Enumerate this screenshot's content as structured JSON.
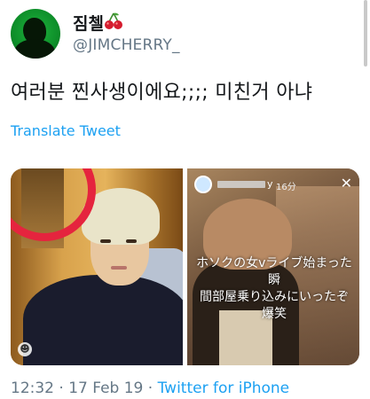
{
  "author": {
    "display_name": "짐첼",
    "handle": "@JIMCHERRY_",
    "emoji": "🍒"
  },
  "tweet": {
    "text": "여러분 찐사생이에요;;;; 미친거 아냐",
    "translate_label": "Translate Tweet"
  },
  "media": {
    "right_story": {
      "username_tail": "y",
      "time": "16分",
      "overlay_text": "ホソクの女vライブ始まった瞬\n間部屋乗り込みにいったぞ爆笑",
      "close_glyph": "✕"
    },
    "left_photo": {
      "badge_glyph": "☻"
    }
  },
  "footer": {
    "timestamp": "12:32 · 17 Feb 19 · ",
    "source": "Twitter for iPhone"
  },
  "colors": {
    "link": "#1da1f2",
    "muted": "#657786",
    "circle_highlight": "#e5243e"
  }
}
